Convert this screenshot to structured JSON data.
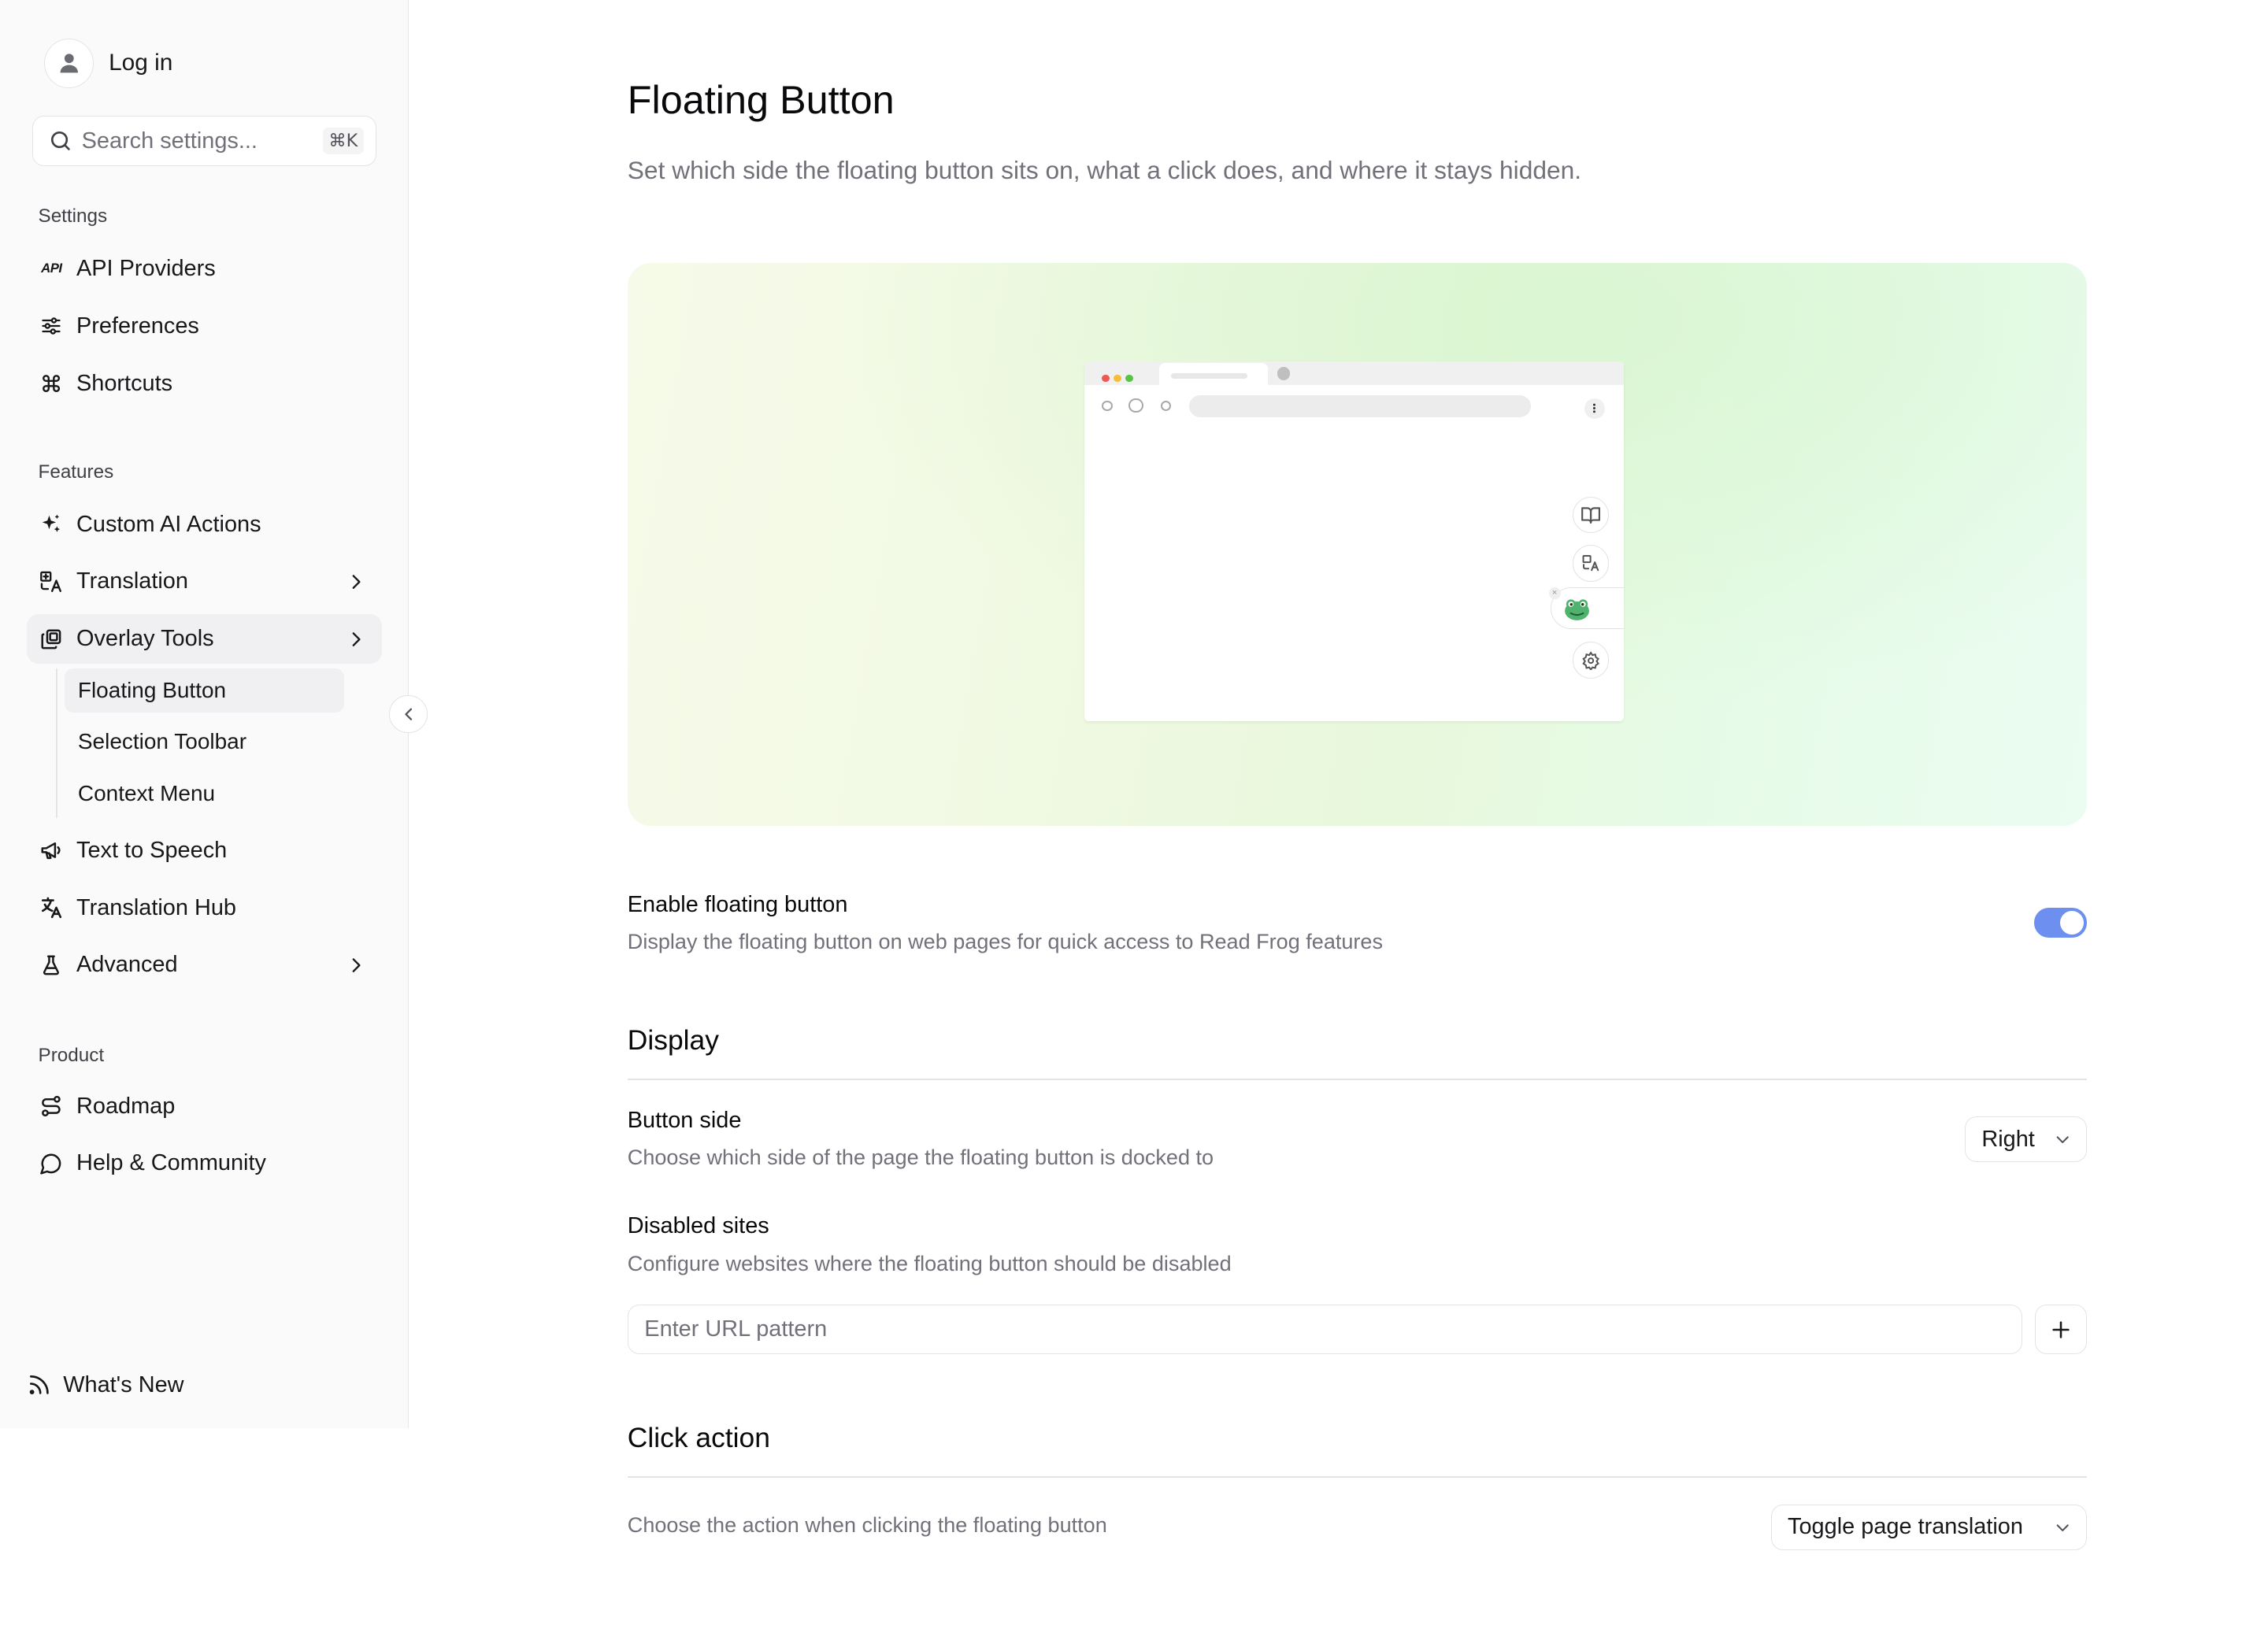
{
  "sidebar": {
    "login_label": "Log in",
    "search": {
      "placeholder": "Search settings...",
      "shortcut": "⌘K"
    },
    "groups": {
      "settings": "Settings",
      "features": "Features",
      "product": "Product"
    },
    "items": {
      "api_providers": "API Providers",
      "preferences": "Preferences",
      "shortcuts": "Shortcuts",
      "custom_ai_actions": "Custom AI Actions",
      "translation": "Translation",
      "overlay_tools": "Overlay Tools",
      "text_to_speech": "Text to Speech",
      "translation_hub": "Translation Hub",
      "advanced": "Advanced",
      "roadmap": "Roadmap",
      "help_community": "Help & Community"
    },
    "api_icon_text": "API",
    "overlay_sub_items": [
      "Floating Button",
      "Selection Toolbar",
      "Context Menu"
    ],
    "active_sub_item": "Floating Button",
    "whats_new": "What's New"
  },
  "main": {
    "title": "Floating Button",
    "description": "Set which side the floating button sits on, what a click does, and where it stays hidden.",
    "enable": {
      "title": "Enable floating button",
      "description": "Display the floating button on web pages for quick access to Read Frog features",
      "enabled": true
    },
    "display_section": "Display",
    "button_side": {
      "title": "Button side",
      "description": "Choose which side of the page the floating button is docked to",
      "value": "Right"
    },
    "disabled_sites": {
      "title": "Disabled sites",
      "description": "Configure websites where the floating button should be disabled",
      "placeholder": "Enter URL pattern"
    },
    "click_action_section": "Click action",
    "click_action": {
      "description": "Choose the action when clicking the floating button",
      "value": "Toggle page translation"
    }
  },
  "colors": {
    "accent": "#6d8ff0",
    "sidebar_bg": "#fafafa",
    "frog": "#4fb36d"
  }
}
